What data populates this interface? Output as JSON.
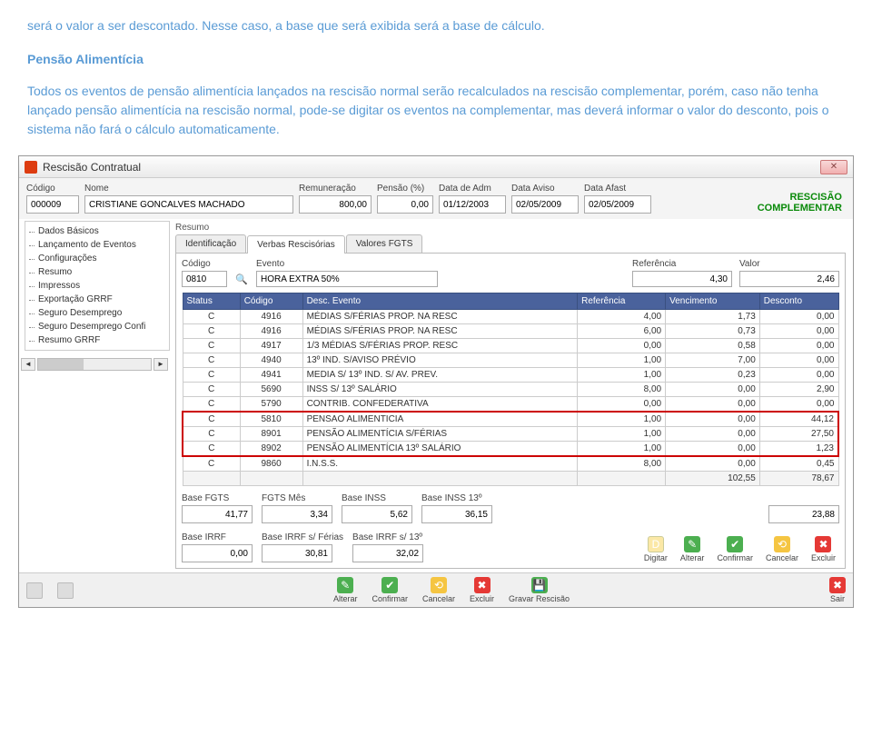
{
  "doc": {
    "p1": "será o valor a ser descontado. Nesse caso, a base que será exibida será a base de cálculo.",
    "p2": "Pensão Alimentícia",
    "p3": "Todos os eventos de pensão alimentícia lançados na rescisão normal serão recalculados na rescisão complementar, porém, caso não tenha lançado pensão alimentícia na rescisão normal, pode-se digitar os eventos na complementar, mas deverá informar o valor do desconto, pois o sistema não fará o cálculo automaticamente."
  },
  "window": {
    "title": "Rescisão Contratual",
    "close": "✕",
    "banner1": "RESCISÃO",
    "banner2": "COMPLEMENTAR"
  },
  "header": {
    "codigo_label": "Código",
    "codigo": "000009",
    "nome_label": "Nome",
    "nome": "CRISTIANE GONCALVES MACHADO",
    "remun_label": "Remuneração",
    "remun": "800,00",
    "pensao_label": "Pensão (%)",
    "pensao": "0,00",
    "adm_label": "Data de Adm",
    "adm": "01/12/2003",
    "aviso_label": "Data Aviso",
    "aviso": "02/05/2009",
    "afast_label": "Data Afast",
    "afast": "02/05/2009"
  },
  "tree": {
    "items": [
      "Dados Básicos",
      "Lançamento de Eventos",
      "Configurações",
      "Resumo",
      "Impressos",
      "Exportação GRRF",
      "Seguro Desemprego",
      "Seguro Desemprego Confi",
      "Resumo GRRF"
    ]
  },
  "resumo_label": "Resumo",
  "tabs": {
    "t0": "Identificação",
    "t1": "Verbas Rescisórias",
    "t2": "Valores FGTS"
  },
  "event_row": {
    "codigo_label": "Código",
    "codigo": "0810",
    "evento_label": "Evento",
    "evento": "HORA EXTRA 50%",
    "ref_label": "Referência",
    "ref": "4,30",
    "valor_label": "Valor",
    "valor": "2,46"
  },
  "grid": {
    "headers": [
      "Status",
      "Código",
      "Desc. Evento",
      "Referência",
      "Vencimento",
      "Desconto"
    ],
    "rows": [
      {
        "s": "C",
        "c": "4916",
        "d": "MÉDIAS S/FÉRIAS PROP. NA RESC",
        "r": "4,00",
        "v": "1,73",
        "x": "0,00",
        "hl": false
      },
      {
        "s": "C",
        "c": "4916",
        "d": "MÉDIAS S/FÉRIAS PROP. NA RESC",
        "r": "6,00",
        "v": "0,73",
        "x": "0,00",
        "hl": false
      },
      {
        "s": "C",
        "c": "4917",
        "d": "1/3 MÉDIAS S/FÉRIAS PROP. RESC",
        "r": "0,00",
        "v": "0,58",
        "x": "0,00",
        "hl": false
      },
      {
        "s": "C",
        "c": "4940",
        "d": "13º IND. S/AVISO PRÉVIO",
        "r": "1,00",
        "v": "7,00",
        "x": "0,00",
        "hl": false
      },
      {
        "s": "C",
        "c": "4941",
        "d": "MEDIA S/ 13º IND. S/ AV. PREV.",
        "r": "1,00",
        "v": "0,23",
        "x": "0,00",
        "hl": false
      },
      {
        "s": "C",
        "c": "5690",
        "d": "INSS S/ 13º SALÁRIO",
        "r": "8,00",
        "v": "0,00",
        "x": "2,90",
        "hl": false
      },
      {
        "s": "C",
        "c": "5790",
        "d": "CONTRIB. CONFEDERATIVA",
        "r": "0,00",
        "v": "0,00",
        "x": "0,00",
        "hl": false
      },
      {
        "s": "C",
        "c": "5810",
        "d": "PENSAO ALIMENTICIA",
        "r": "1,00",
        "v": "0,00",
        "x": "44,12",
        "hl": true
      },
      {
        "s": "C",
        "c": "8901",
        "d": "PENSÃO ALIMENTÍCIA S/FÉRIAS",
        "r": "1,00",
        "v": "0,00",
        "x": "27,50",
        "hl": true
      },
      {
        "s": "C",
        "c": "8902",
        "d": "PENSÃO ALIMENTÍCIA 13º SALÁRIO",
        "r": "1,00",
        "v": "0,00",
        "x": "1,23",
        "hl": true
      },
      {
        "s": "C",
        "c": "9860",
        "d": "I.N.S.S.",
        "r": "8,00",
        "v": "0,00",
        "x": "0,45",
        "hl": false
      }
    ],
    "totals": {
      "v": "102,55",
      "x": "78,67"
    }
  },
  "bases": {
    "fgts_l": "Base FGTS",
    "fgts": "41,77",
    "fgtsm_l": "FGTS Mês",
    "fgtsm": "3,34",
    "inss_l": "Base INSS",
    "inss": "5,62",
    "inss13_l": "Base INSS 13º",
    "inss13": "36,15",
    "total": "23,88",
    "irrf_l": "Base IRRF",
    "irrf": "0,00",
    "irrff_l": "Base IRRF s/ Férias",
    "irrff": "30,81",
    "irrf13_l": "Base IRRF s/ 13º",
    "irrf13": "32,02"
  },
  "actions": {
    "digitar": "Digitar",
    "alterar": "Alterar",
    "confirmar": "Confirmar",
    "cancelar": "Cancelar",
    "excluir": "Excluir",
    "gravar": "Gravar Rescisão",
    "sair": "Sair",
    "d": "D"
  }
}
